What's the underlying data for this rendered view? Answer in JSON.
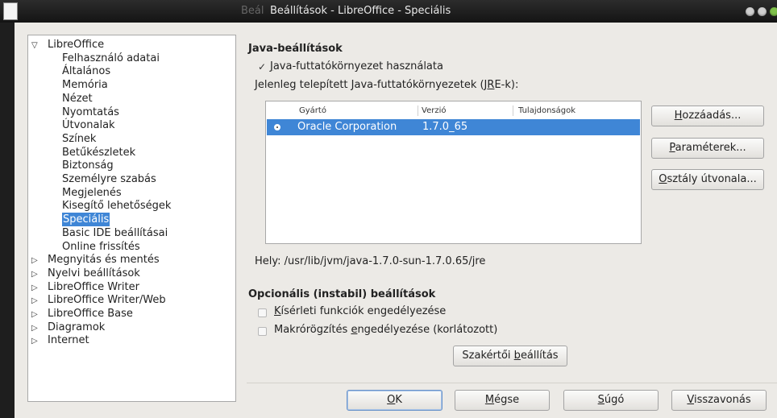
{
  "window": {
    "title_prefix": "Beál",
    "title": "Beállítások - LibreOffice - Speciális"
  },
  "tree": {
    "root": "LibreOffice",
    "children": [
      "Felhasználó adatai",
      "Általános",
      "Memória",
      "Nézet",
      "Nyomtatás",
      "Útvonalak",
      "Színek",
      "Betűkészletek",
      "Biztonság",
      "Személyre szabás",
      "Megjelenés",
      "Kisegítő lehetőségek",
      "Speciális",
      "Basic IDE beállításai",
      "Online frissítés"
    ],
    "selected": "Speciális",
    "others": [
      "Megnyitás és mentés",
      "Nyelvi beállítások",
      "LibreOffice Writer",
      "LibreOffice Writer/Web",
      "LibreOffice Base",
      "Diagramok",
      "Internet"
    ]
  },
  "java": {
    "heading": "Java-beállítások",
    "use_jre_pre": "",
    "use_jre_u": "J",
    "use_jre_post": "ava-futtatókörnyezet használata",
    "use_jre_checked": true,
    "installed_pre": "Jelenleg telepített Java-futtatókörnyezetek (J",
    "installed_u": "R",
    "installed_post": "E-k):",
    "columns": [
      "Gyártó",
      "Verzió",
      "Tulajdonságok"
    ],
    "rows": [
      {
        "vendor": "Oracle Corporation",
        "version": "1.7.0_65",
        "features": "",
        "selected": true
      }
    ],
    "location": "Hely: /usr/lib/jvm/java-1.7.0-sun-1.7.0.65/jre"
  },
  "side_buttons": {
    "add": {
      "u": "H",
      "rest": "ozzáadás..."
    },
    "params": {
      "u": "P",
      "rest": "araméterek..."
    },
    "classpath": {
      "u": "O",
      "rest": "sztály útvonala..."
    }
  },
  "optional": {
    "heading": "Opcionális (instabil) beállítások",
    "experimental_u": "K",
    "experimental_rest": "ísérleti funkciók engedélyezése",
    "macro_pre": "Makrórögzítés ",
    "macro_u": "e",
    "macro_rest": "ngedélyezése (korlátozott)",
    "expert_pre": "Szakértői ",
    "expert_u": "b",
    "expert_rest": "eállítás"
  },
  "footer": {
    "ok_u": "O",
    "ok_rest": "K",
    "cancel_u": "M",
    "cancel_rest": "égse",
    "help_u": "S",
    "help_rest": "úgó",
    "revert_u": "V",
    "revert_rest": "isszavonás"
  }
}
